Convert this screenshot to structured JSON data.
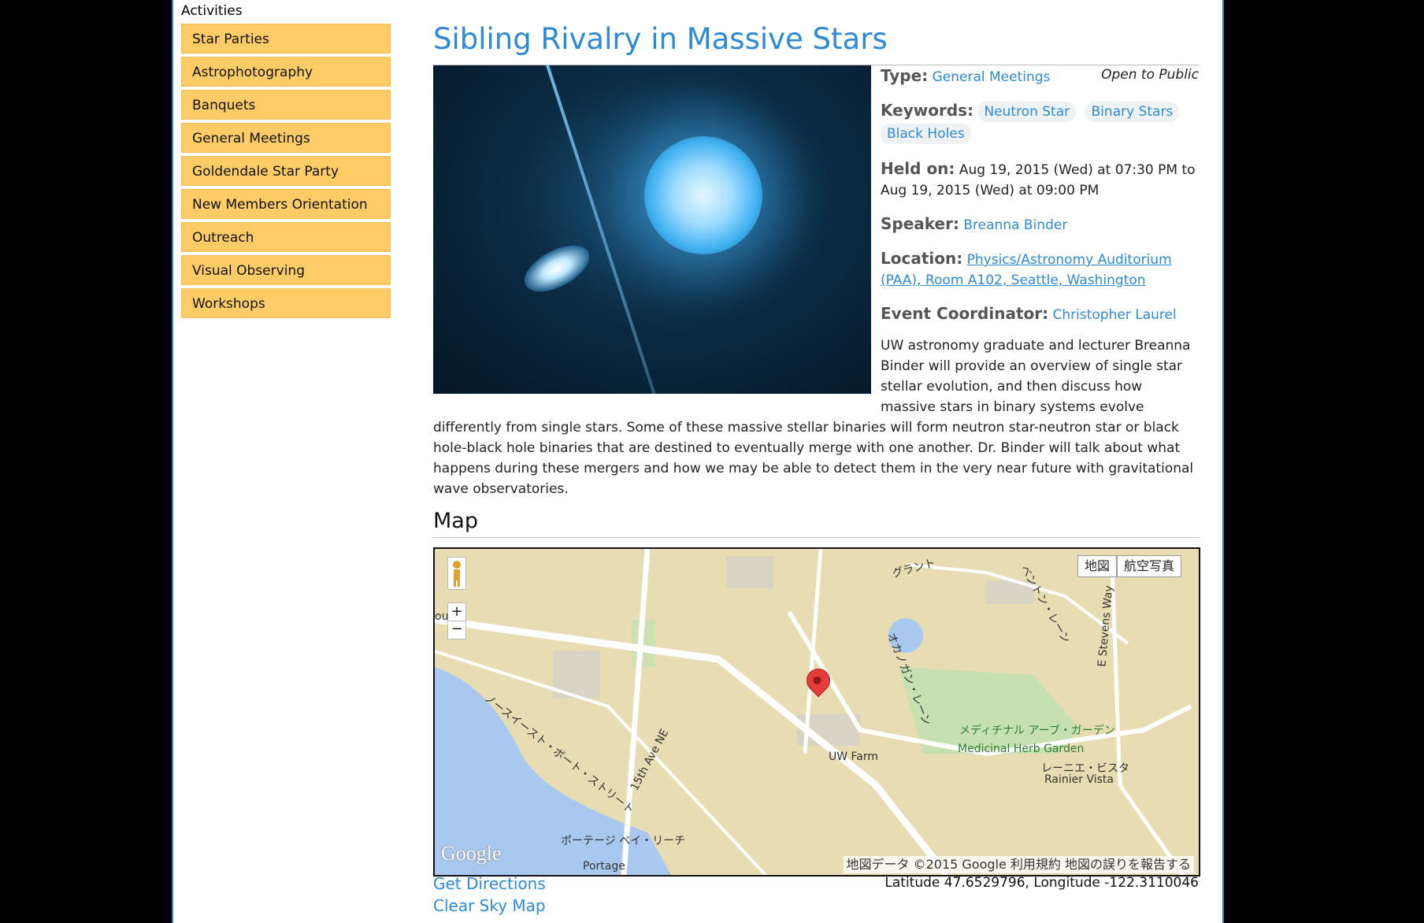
{
  "sidebar": {
    "title": "Activities",
    "items": [
      {
        "label": "Star Parties"
      },
      {
        "label": "Astrophotography"
      },
      {
        "label": "Banquets"
      },
      {
        "label": "General Meetings"
      },
      {
        "label": "Goldendale Star Party"
      },
      {
        "label": "New Members Orientation"
      },
      {
        "label": "Outreach"
      },
      {
        "label": "Visual Observing"
      },
      {
        "label": "Workshops"
      }
    ]
  },
  "event": {
    "title": "Sibling Rivalry in Massive Stars",
    "type_label": "Type:",
    "type_value": "General Meetings",
    "open_to_public": "Open to Public",
    "keywords_label": "Keywords:",
    "keywords": [
      "Neutron Star",
      "Binary Stars",
      "Black Holes"
    ],
    "held_label": "Held on:",
    "held_value": "Aug 19, 2015 (Wed) at 07:30 PM to Aug 19, 2015 (Wed) at 09:00 PM",
    "speaker_label": "Speaker:",
    "speaker_value": "Breanna Binder",
    "location_label": "Location:",
    "location_value": "Physics/Astronomy Auditorium (PAA), Room A102, Seattle, Washington",
    "coordinator_label": "Event Coordinator:",
    "coordinator_value": "Christopher Laurel",
    "description": "UW astronomy graduate and lecturer Breanna Binder will provide an overview of single star stellar evolution, and then discuss how massive stars in binary systems evolve differently from single stars. Some of these massive stellar binaries will form neutron star-neutron star or black hole-black hole binaries that are destined to eventually merge with one another. Dr. Binder will talk about what happens during these mergers and how we may be able to detect them in the very near future with gravitational wave observatories."
  },
  "map": {
    "heading": "Map",
    "type_map": "地図",
    "type_satellite": "航空写真",
    "zoom_in": "+",
    "zoom_out": "−",
    "logo": "Google",
    "attribution": "地図データ ©2015 Google   利用規約   地図の誤りを報告する",
    "labels": {
      "street_15th": "15th Ave NE",
      "uw_farm": "UW Farm",
      "herb_garden_jp": "メディチナル アーブ・ガーデン",
      "herb_garden": "Medicinal Herb Garden",
      "rainier_jp": "レーニエ・ビスタ",
      "rainier": "Rainier Vista",
      "stevens_way": "E Stevens Way",
      "okanogan": "オカノガン・レーン",
      "portage_jp": "ポーテージ ベイ・リーチ",
      "portage": "Portage",
      "northeast_boat": "ノースイースト・ボート・ストリート",
      "grant": "グラント",
      "benton": "ベントン・レーン",
      "left_edge": "ou"
    }
  },
  "footer": {
    "get_directions": "Get Directions",
    "clear_sky_map": "Clear Sky Map",
    "latlon": "Latitude 47.6529796, Longitude -122.3110046"
  },
  "colors": {
    "accent": "#2e8ad6",
    "menu_bg": "#fecc66",
    "frame": "#3a7bc8"
  }
}
